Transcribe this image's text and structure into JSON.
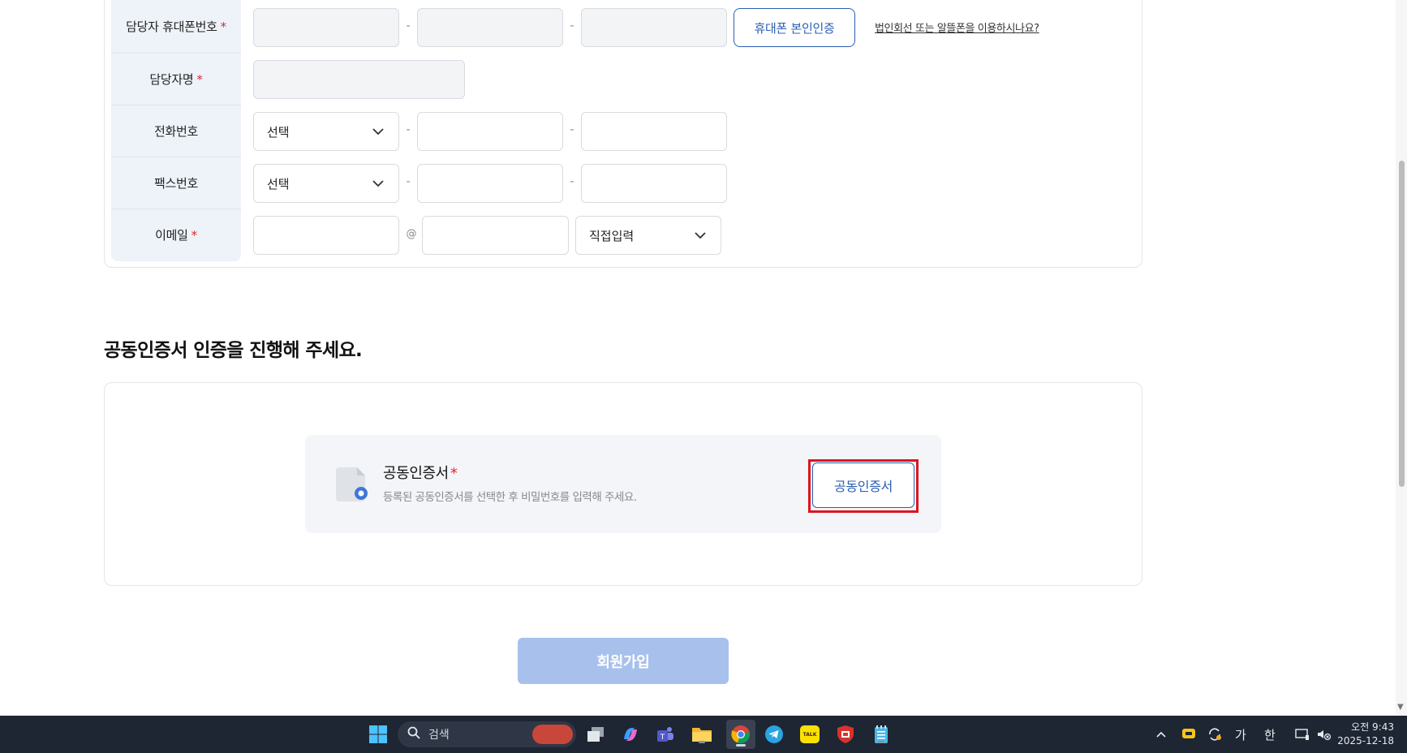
{
  "form": {
    "mobile": {
      "label": "담당자 휴대폰번호",
      "required_mark": "*",
      "dash": "-",
      "verify_button": "휴대폰 본인인증",
      "help_link": "법인회선 또는 알뜰폰을 이용하시나요?"
    },
    "name": {
      "label": "담당자명",
      "required_mark": "*"
    },
    "phone": {
      "label": "전화번호",
      "select_value": "선택",
      "dash": "-"
    },
    "fax": {
      "label": "팩스번호",
      "select_value": "선택",
      "dash": "-"
    },
    "email": {
      "label": "이메일",
      "required_mark": "*",
      "at": "@",
      "domain_select": "직접입력"
    }
  },
  "cert_section": {
    "title": "공동인증서 인증을 진행해 주세요.",
    "card_title": "공동인증서",
    "required_mark": "*",
    "description": "등록된 공동인증서를 선택한 후 비밀번호를 입력해 주세요.",
    "button": "공동인증서"
  },
  "submit": {
    "label": "회원가입"
  },
  "taskbar": {
    "search_placeholder": "검색",
    "ime_lang": "가",
    "ime_mode": "한",
    "time": "오전 9:43",
    "date": "2025-12-18",
    "talk_label": "TALK"
  },
  "colors": {
    "accent": "#2b5fb4",
    "required": "#e0262e",
    "label_bg": "#eef3fa",
    "submit_disabled": "#a7c1ec",
    "highlight": "#e0141c"
  }
}
